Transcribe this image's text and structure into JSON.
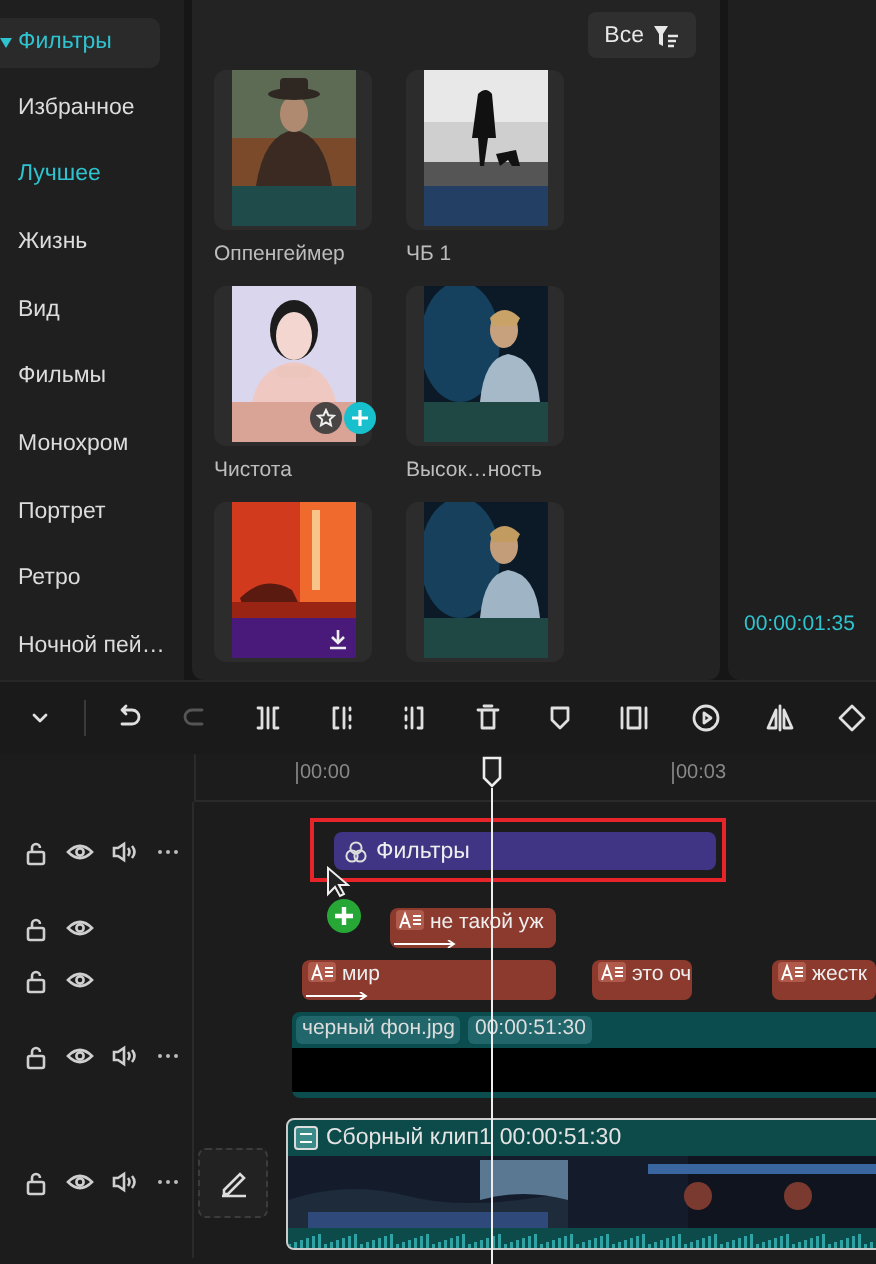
{
  "sidebar": {
    "header": {
      "label": "Фильтры",
      "expanded": true
    },
    "items": [
      {
        "label": "Избранное",
        "selected": false
      },
      {
        "label": "Лучшее",
        "selected": true
      },
      {
        "label": "Жизнь",
        "selected": false
      },
      {
        "label": "Вид",
        "selected": false
      },
      {
        "label": "Фильмы",
        "selected": false
      },
      {
        "label": "Монохром",
        "selected": false
      },
      {
        "label": "Портрет",
        "selected": false
      },
      {
        "label": "Ретро",
        "selected": false
      },
      {
        "label": "Ночной пей…",
        "selected": false
      }
    ]
  },
  "filter_panel": {
    "sort_button": "Все",
    "filters": [
      {
        "name": "Оппенгеймер",
        "color": "#1f4b4b",
        "hovered": false,
        "download": false
      },
      {
        "name": "ЧБ 1",
        "color": "#233f63",
        "hovered": false,
        "download": false
      },
      {
        "name": "Чистота",
        "color": "#d9a396",
        "hovered": true,
        "download": false
      },
      {
        "name": "Высок…ность",
        "color": "#1f4744",
        "hovered": false,
        "download": false
      },
      {
        "color": "#4a1a7a",
        "hovered": false,
        "download": true
      },
      {
        "color": "#1f4744",
        "hovered": false,
        "download": false
      }
    ]
  },
  "preview": {
    "timecode": "00:00:01:35"
  },
  "toolbar": {
    "undo": {
      "disabled": false
    },
    "redo": {
      "disabled": true
    }
  },
  "ruler": {
    "labels": [
      "00:00",
      "00:03"
    ]
  },
  "tracks": [
    {
      "kind": "filter",
      "audio": true,
      "clips": [
        {
          "label": "Фильтры",
          "highlighted": true
        }
      ]
    },
    {
      "kind": "text",
      "audio": false,
      "clips": [
        {
          "label": "не такой уж",
          "animated": true
        }
      ]
    },
    {
      "kind": "text",
      "audio": false,
      "clips": [
        {
          "label": "мир",
          "animated": true
        },
        {
          "label": "это оч",
          "animated": false
        },
        {
          "label": "жестк",
          "animated": false
        }
      ]
    },
    {
      "kind": "video",
      "audio": true,
      "clips": [
        {
          "label": "черный фон.jpg",
          "duration": "00:00:51:30"
        }
      ]
    },
    {
      "kind": "main",
      "audio": true,
      "clips": [
        {
          "label": "Сборный клип1",
          "duration": "00:00:51:30"
        }
      ]
    }
  ]
}
